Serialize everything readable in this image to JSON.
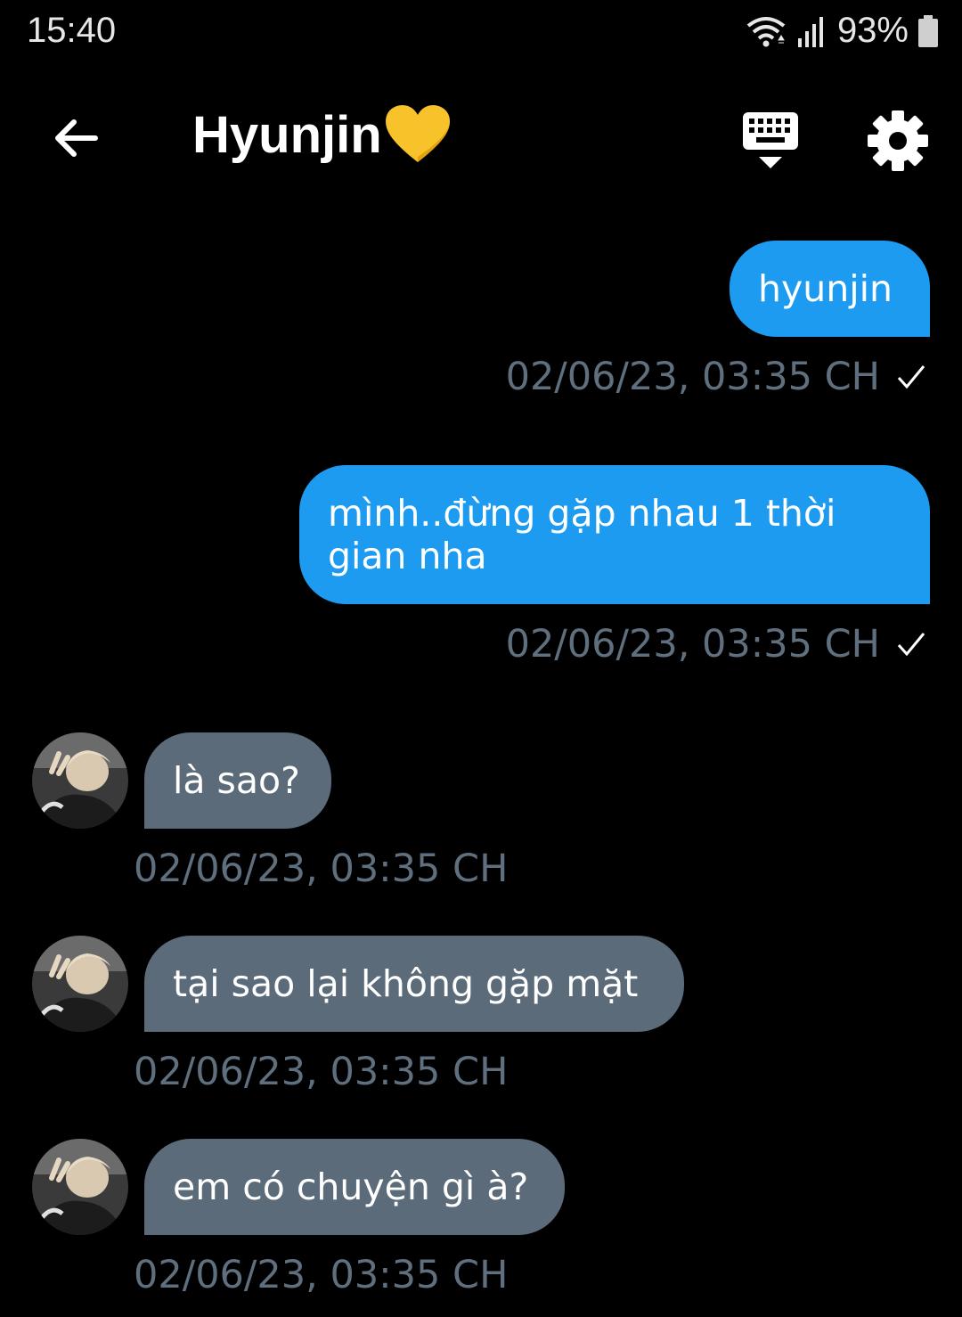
{
  "status_bar": {
    "time": "15:40",
    "battery": "93%",
    "icons": [
      "wifi-icon",
      "signal-icon",
      "battery-icon"
    ]
  },
  "header": {
    "title": "Hyunjin",
    "title_emoji": "💛",
    "icons": [
      "back-arrow-icon",
      "keyboard-icon",
      "gear-icon"
    ]
  },
  "colors": {
    "background": "#000000",
    "outgoing_bubble": "#1d9bf0",
    "incoming_bubble": "#5b6b7a",
    "timestamp": "#5f6f7e",
    "heart": "#f7c22a"
  },
  "messages": [
    {
      "direction": "out",
      "text": "hyunjin",
      "time": "02/06/23, 03:35 CH",
      "status": "sent"
    },
    {
      "direction": "out",
      "text": "mình..đừng gặp nhau 1 thời gian nha",
      "time": "02/06/23, 03:35 CH",
      "status": "sent"
    },
    {
      "direction": "in",
      "text": "là sao?",
      "time": "02/06/23, 03:35 CH"
    },
    {
      "direction": "in",
      "text": "tại sao lại không gặp mặt",
      "time": "02/06/23, 03:35 CH"
    },
    {
      "direction": "in",
      "text": "em có chuyện gì à?",
      "time": "02/06/23, 03:35 CH"
    }
  ]
}
